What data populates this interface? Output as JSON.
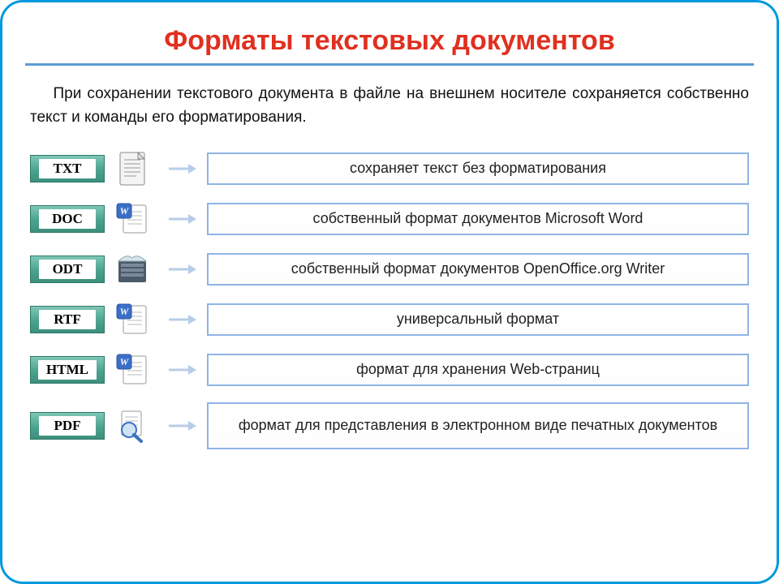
{
  "title": "Форматы текстовых документов",
  "intro": "При сохранении текстового документа в файле на внешнем носителе сохраняется собственно текст и команды его форматирования.",
  "formats": [
    {
      "tag": "TXT",
      "icon": "txt",
      "desc": "сохраняет текст без форматирования"
    },
    {
      "tag": "DOC",
      "icon": "doc",
      "desc": "собственный формат документов Microsoft Word"
    },
    {
      "tag": "ODT",
      "icon": "odt",
      "desc": "собственный формат документов OpenOffice.org Writer"
    },
    {
      "tag": "RTF",
      "icon": "rtf",
      "desc": "универсальный формат"
    },
    {
      "tag": "HTML",
      "icon": "html",
      "desc": "формат для хранения Web-страниц"
    },
    {
      "tag": "PDF",
      "icon": "pdf",
      "desc": "формат для представления в электронном виде печатных документов"
    }
  ]
}
